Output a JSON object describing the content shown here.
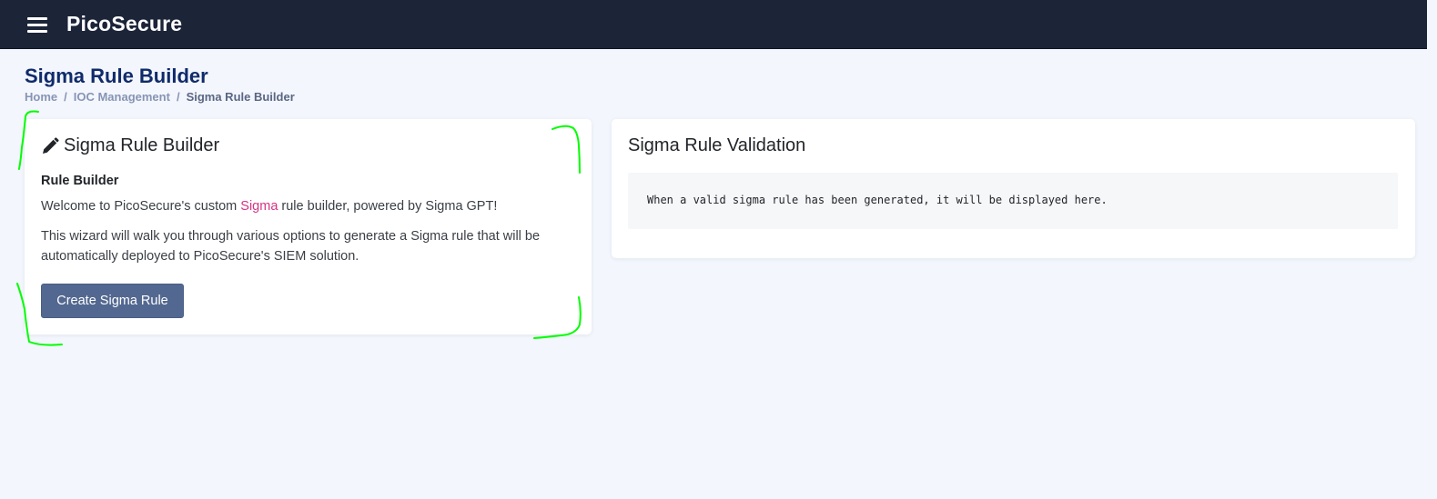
{
  "app": {
    "brand": "PicoSecure",
    "menu_icon": "hamburger-icon"
  },
  "page": {
    "title": "Sigma Rule Builder",
    "breadcrumb": [
      "Home",
      "IOC Management",
      "Sigma Rule Builder"
    ]
  },
  "builder_card": {
    "icon": "pencil-icon",
    "title": "Sigma Rule Builder",
    "subtitle": "Rule Builder",
    "intro_before": "Welcome to PicoSecure's custom ",
    "intro_highlight": "Sigma",
    "intro_after": " rule builder, powered by Sigma GPT!",
    "description": "This wizard will walk you through various options to generate a Sigma rule that will be automatically deployed to PicoSecure's SIEM solution.",
    "button_label": "Create Sigma Rule"
  },
  "validation_card": {
    "title": "Sigma Rule Validation",
    "placeholder_text": "When a valid sigma rule has been generated, it will be displayed here."
  },
  "colors": {
    "topbar": "#1c2438",
    "title": "#102b6b",
    "button": "#536890",
    "highlight": "#d63384",
    "annotation": "#00ff00",
    "background": "#f3f6fc"
  }
}
